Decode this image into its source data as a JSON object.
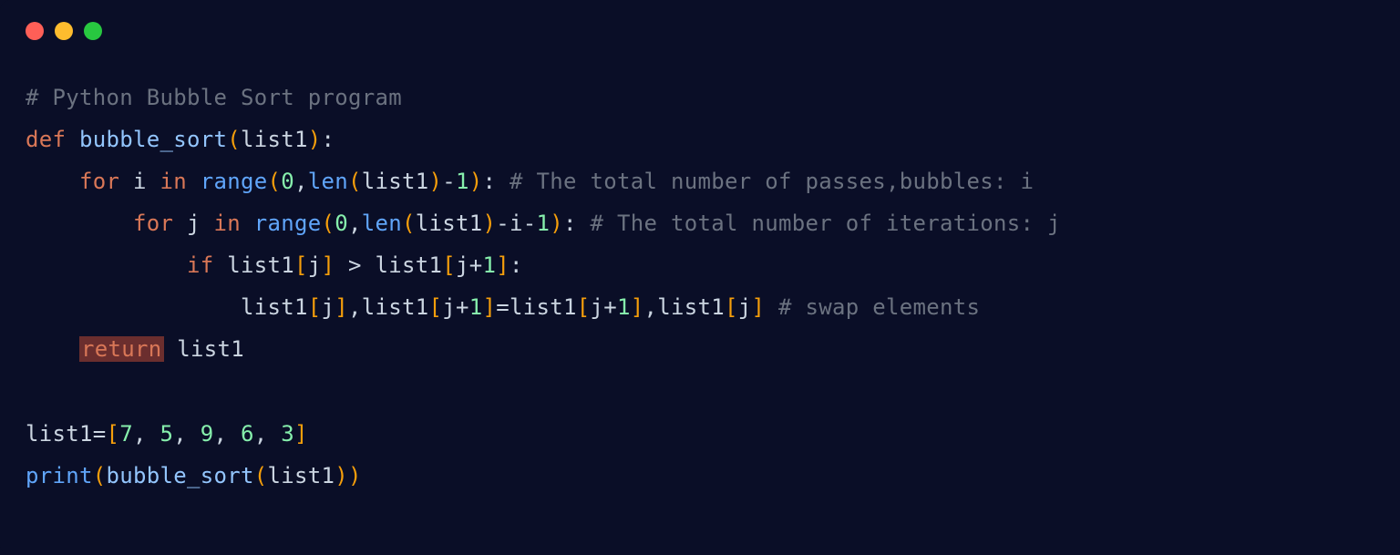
{
  "titlebar": {
    "buttons": [
      "close",
      "minimize",
      "zoom"
    ]
  },
  "code": {
    "line1_comment": "# Python Bubble Sort program",
    "line2_def": "def",
    "line2_func": "bubble_sort",
    "line2_param": "list1",
    "line3_indent": "    ",
    "line3_for": "for",
    "line3_i": "i",
    "line3_in": "in",
    "line3_range": "range",
    "line3_zero": "0",
    "line3_len": "len",
    "line3_list1": "list1",
    "line3_minus1": "1",
    "line3_comment": "# The total number of passes,bubbles: i",
    "line4_indent": "        ",
    "line4_for": "for",
    "line4_j": "j",
    "line4_in": "in",
    "line4_range": "range",
    "line4_zero": "0",
    "line4_len": "len",
    "line4_list1": "list1",
    "line4_i": "i",
    "line4_one": "1",
    "line4_comment": "# The total number of iterations: j",
    "line5_indent": "            ",
    "line5_if": "if",
    "line5_list1a": "list1",
    "line5_j1": "j",
    "line5_gt": ">",
    "line5_list1b": "list1",
    "line5_j2": "j",
    "line5_plus1": "1",
    "line6_indent": "                ",
    "line6_list1a": "list1",
    "line6_j1": "j",
    "line6_list1b": "list1",
    "line6_j2": "j",
    "line6_plus1a": "1",
    "line6_list1c": "list1",
    "line6_j3": "j",
    "line6_plus1b": "1",
    "line6_list1d": "list1",
    "line6_j4": "j",
    "line6_comment": "# swap elements",
    "line7_indent": "    ",
    "line7_return": "return",
    "line7_list1": "list1",
    "line9_list1": "list1",
    "line9_val1": "7",
    "line9_val2": "5",
    "line9_val3": "9",
    "line9_val4": "6",
    "line9_val5": "3",
    "line10_print": "print",
    "line10_func": "bubble_sort",
    "line10_arg": "list1"
  }
}
